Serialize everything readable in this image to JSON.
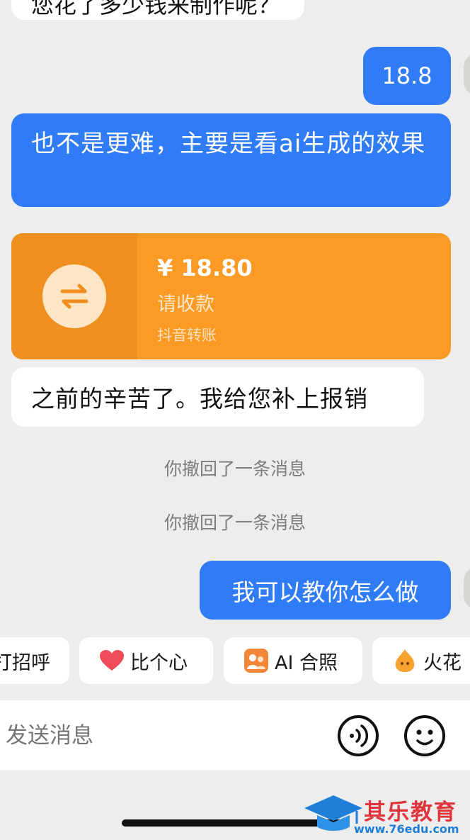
{
  "messages": [
    {
      "text": "您花了多少钱来制作呢？"
    },
    {
      "text": "18.8"
    },
    {
      "text": "也不是更难，主要是看ai生成的效果"
    },
    {
      "text": "之前的辛苦了。我给您补上报销"
    },
    {
      "text": "我可以教你怎么做"
    }
  ],
  "transfer": {
    "amount": "¥ 18.80",
    "status": "请收款",
    "source": "抖音转账"
  },
  "system": [
    "你撤回了一条消息",
    "你撤回了一条消息"
  ],
  "quick_actions": [
    {
      "label": "打招呼",
      "icon": "wave-icon"
    },
    {
      "label": "比个心",
      "icon": "heart-icon"
    },
    {
      "label": "AI 合照",
      "icon": "ai-photo-icon"
    },
    {
      "label": "火花",
      "icon": "spark-icon"
    }
  ],
  "composer": {
    "placeholder": "发送消息"
  },
  "watermark": {
    "name": "其乐教育",
    "url": "www.76edu.com"
  },
  "colors": {
    "blue": "#2f7cf6",
    "orange": "#fb9b25",
    "orange_dark": "#ef8f1f",
    "background": "#ededed"
  }
}
